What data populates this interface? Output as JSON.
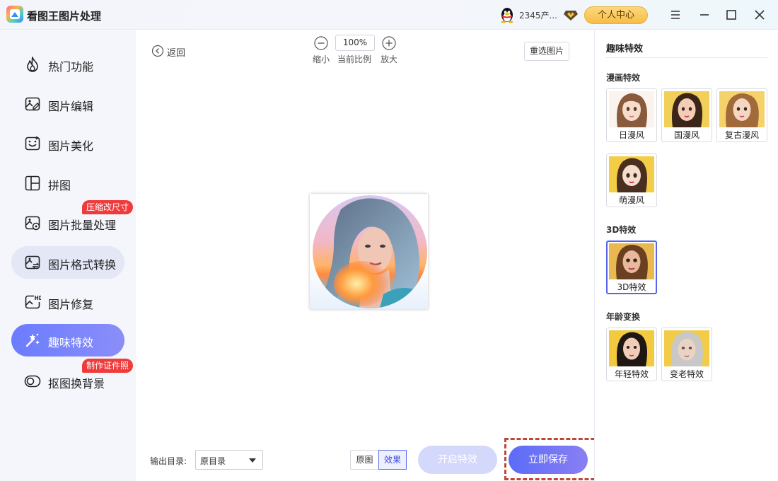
{
  "app": {
    "title": "看图王图片处理"
  },
  "header": {
    "user_name": "2345产...",
    "center_button": "个人中心"
  },
  "sidebar": {
    "items": [
      {
        "label": "热门功能",
        "icon": "flame-icon"
      },
      {
        "label": "图片编辑",
        "icon": "image-edit-icon"
      },
      {
        "label": "图片美化",
        "icon": "image-beautify-icon"
      },
      {
        "label": "拼图",
        "icon": "collage-icon"
      },
      {
        "label": "图片批量处理",
        "icon": "batch-image-icon",
        "badge": "压缩改尺寸"
      },
      {
        "label": "图片格式转换",
        "icon": "format-convert-icon"
      },
      {
        "label": "图片修复",
        "icon": "hd-repair-icon"
      },
      {
        "label": "趣味特效",
        "icon": "magic-wand-icon"
      },
      {
        "label": "抠图换背景",
        "icon": "cutout-icon",
        "badge": "制作证件照"
      }
    ],
    "active_index": 7
  },
  "toolbar": {
    "back_label": "返回",
    "zoom_value": "100%",
    "zoom_out_label": "缩小",
    "zoom_current_label": "当前比例",
    "zoom_in_label": "放大",
    "reselect_label": "重选图片"
  },
  "footer": {
    "output_label": "输出目录:",
    "output_value": "原目录",
    "view_original": "原图",
    "view_effect": "效果",
    "start_label": "开启特效",
    "save_label": "立即保存"
  },
  "panel": {
    "title": "趣味特效",
    "sections": [
      {
        "title": "漫画特效",
        "items": [
          "日漫风",
          "国漫风",
          "复古漫风",
          "萌漫风"
        ]
      },
      {
        "title": "3D特效",
        "items": [
          "3D特效"
        ],
        "selected": "3D特效"
      },
      {
        "title": "年龄变换",
        "items": [
          "年轻特效",
          "变老特效"
        ]
      }
    ]
  },
  "colors": {
    "accent": "#6b7cff",
    "badge": "#ef3b3b",
    "vip_gold": "#f6bd45",
    "highlight_dash": "#c0463a"
  }
}
